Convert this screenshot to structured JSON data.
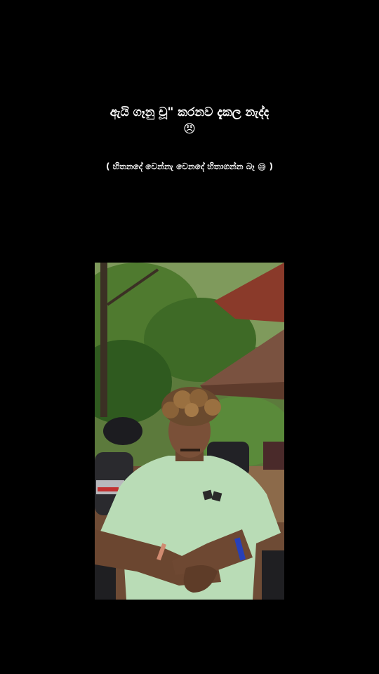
{
  "caption": {
    "line1": "ඇයි ගෑනු චූ\" කරනව දැකල නැද්ද",
    "line1_emoji": "😠",
    "line2": "( හිතනදේ වෙන්නැ වෙනදේ හිතාගන්න බෑ ",
    "line2_emoji": "😅",
    "line2_end": " )"
  },
  "colors": {
    "background": "#000000",
    "caption_text": "#ffffff",
    "shirt": "#b9dcb6",
    "foliage": "#4a7a2e",
    "roof": "#8a3a2a"
  },
  "photo": {
    "icon": "video-frame-image"
  }
}
